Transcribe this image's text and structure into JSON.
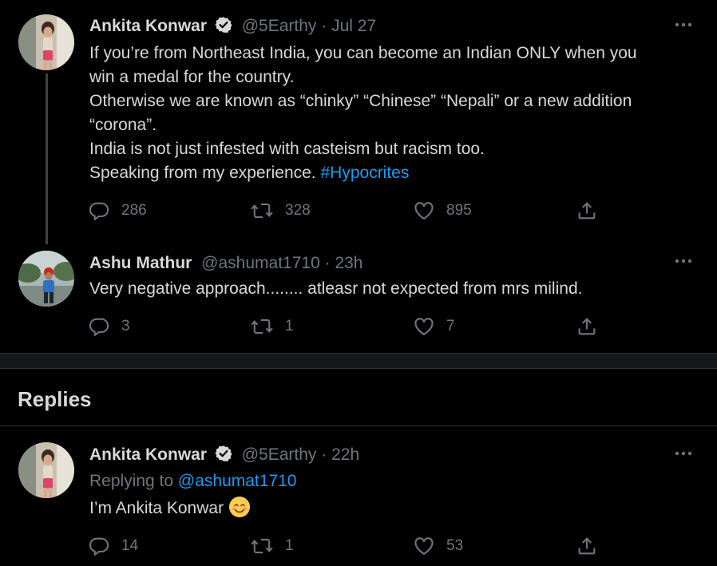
{
  "tweet1": {
    "name": "Ankita Konwar",
    "handle": "@5Earthy",
    "separator": "·",
    "time": "Jul 27",
    "lines": [
      "If you’re from Northeast India, you can become an Indian ONLY when you",
      "win a medal for the country.",
      "Otherwise we are known as “chinky” “Chinese” “Nepali” or a new addition",
      "“corona”.",
      "India is not just infested with casteism but racism too.",
      "Speaking from my experience."
    ],
    "hashtag": "#Hypocrites",
    "replies": "286",
    "retweets": "328",
    "likes": "895"
  },
  "tweet2": {
    "name": "Ashu Mathur",
    "handle": "@ashumat1710",
    "separator": "·",
    "time": "23h",
    "text": "Very negative approach........ atleasr not expected from mrs milind.",
    "replies": "3",
    "retweets": "1",
    "likes": "7"
  },
  "replies_section": {
    "title": "Replies"
  },
  "tweet3": {
    "name": "Ankita Konwar",
    "handle": "@5Earthy",
    "separator": "·",
    "time": "22h",
    "replying_prefix": "Replying to",
    "replying_to": "@ashumat1710",
    "text": "I’m Ankita Konwar",
    "emoji": "smiling-face-icon",
    "replies": "14",
    "retweets": "1",
    "likes": "53"
  },
  "icons": {
    "reply": "reply-icon",
    "retweet": "retweet-icon",
    "like": "heart-icon",
    "share": "share-icon",
    "more": "more-icon",
    "verified": "verified-badge-icon"
  },
  "colors": {
    "background": "#000000",
    "text": "#d9d9d9",
    "muted": "#6e767d",
    "link": "#1d9bf0",
    "divider": "#2f3336"
  }
}
